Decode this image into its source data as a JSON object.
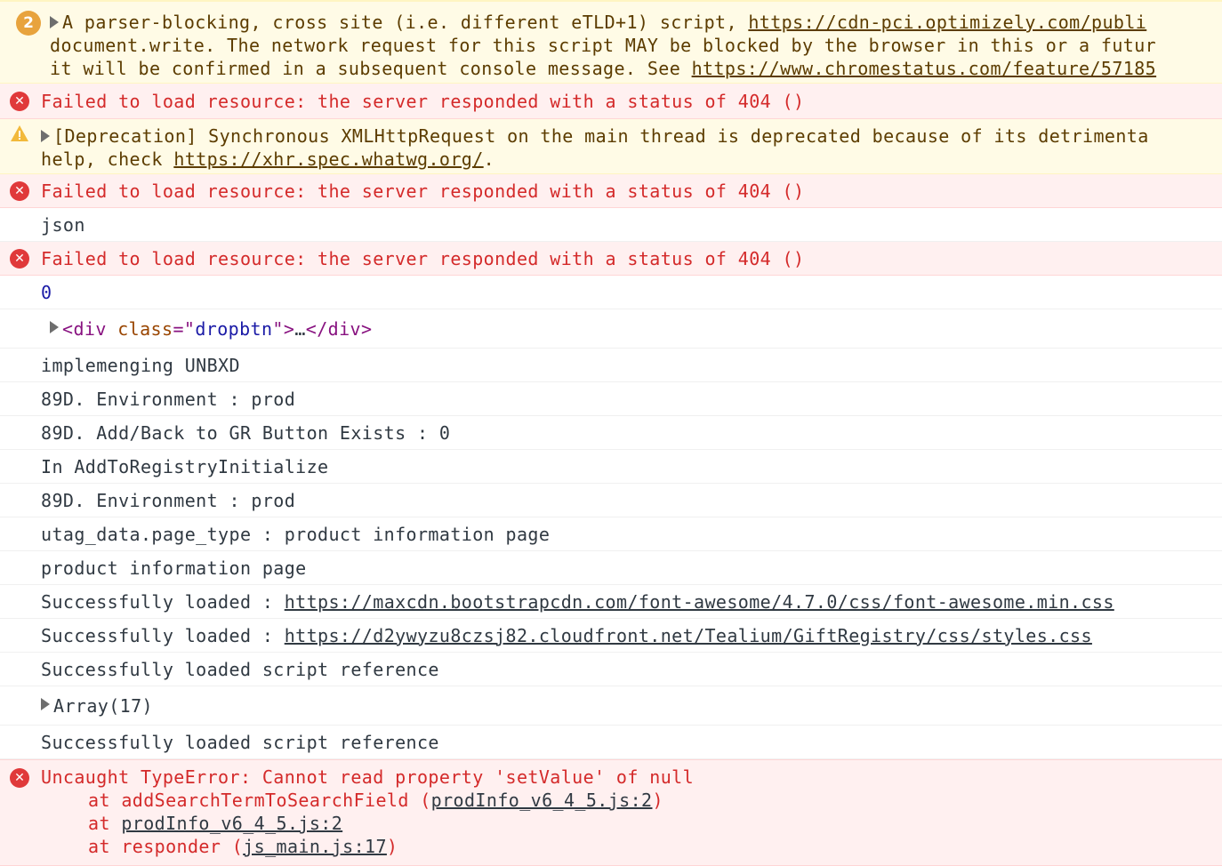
{
  "console": {
    "parser_warning": {
      "count": "2",
      "line1_prefix": "A parser-blocking, cross site (i.e. different eTLD+1) script,",
      "line1_link": "https://cdn-pci.optimizely.com/publi",
      "line2": "document.write. The network request for this script MAY be blocked by the browser in this or a futur",
      "line3_prefix": "it will be confirmed in a subsequent console message. See",
      "line3_link": "https://www.chromestatus.com/feature/57185"
    },
    "error_404": "Failed to load resource: the server responded with a status of 404 ()",
    "deprecation": {
      "line1": "[Deprecation] Synchronous XMLHttpRequest on the main thread is deprecated because of its detrimenta",
      "line2_prefix": "help, check",
      "line2_link": "https://xhr.spec.whatwg.org/",
      "line2_suffix": "."
    },
    "log_json": "json",
    "log_zero": "0",
    "div_element": {
      "open": "<div",
      "attr_name": "class",
      "eq": "=\"",
      "attr_value": "dropbtn",
      "close_quote": "\">",
      "ellipsis": "…",
      "end_tag": "</div>"
    },
    "logs": [
      "implemenging UNBXD",
      "89D. Environment : prod",
      "89D. Add/Back to GR Button Exists : 0",
      "In AddToRegistryInitialize",
      "89D. Environment : prod",
      "utag_data.page_type : product information page",
      "product information page"
    ],
    "loaded_prefix": "Successfully loaded :",
    "loaded_link_1": "https://maxcdn.bootstrapcdn.com/font-awesome/4.7.0/css/font-awesome.min.css",
    "loaded_link_2": "https://d2ywyzu8czsj82.cloudfront.net/Tealium/GiftRegistry/css/styles.css",
    "script_ref": "Successfully loaded script reference",
    "array_label": "Array(17)",
    "type_error": {
      "message": "Uncaught TypeError: Cannot read property 'setValue' of null",
      "frame1_prefix": "at addSearchTermToSearchField (",
      "frame1_link": "prodInfo_v6_4_5.js:2",
      "frame1_suffix": ")",
      "frame2_prefix": "at",
      "frame2_link": "prodInfo_v6_4_5.js:2",
      "frame3_prefix": "at responder (",
      "frame3_link": "js_main.js:17",
      "frame3_suffix": ")"
    },
    "colors": {
      "error_bg": "#fff0f0",
      "error_text": "#d42a2a",
      "warning_bg": "#fffbe6",
      "warning_badge": "#e8a33d",
      "number": "#1a1aa6",
      "tag": "#881280"
    }
  }
}
